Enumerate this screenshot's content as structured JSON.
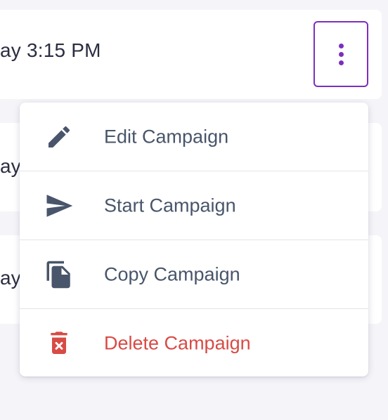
{
  "colors": {
    "page_background": "#f5f5f9",
    "accent": "#7b2fbe",
    "menu_text": "#48556a",
    "danger": "#d84b45"
  },
  "campaign_row": {
    "schedule_text": "ay 3:15 PM",
    "more_button_icon": "more-vertical-icon"
  },
  "background_rows": [
    {
      "partial_text": "ay"
    },
    {
      "partial_text": "ay"
    }
  ],
  "menu": {
    "items": [
      {
        "label": "Edit Campaign",
        "icon": "pencil-icon"
      },
      {
        "label": "Start Campaign",
        "icon": "send-icon"
      },
      {
        "label": "Copy Campaign",
        "icon": "copy-icon"
      },
      {
        "label": "Delete Campaign",
        "icon": "trash-icon"
      }
    ]
  }
}
